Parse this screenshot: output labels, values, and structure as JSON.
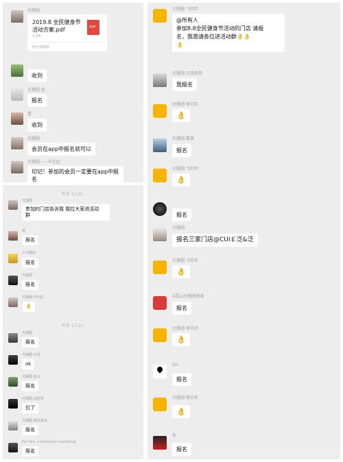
{
  "left_top": {
    "file_msg": {
      "sender": "光猪圈·",
      "file_name_1": "2019.8 全民健身节",
      "file_name_2": "活动方案.pdf",
      "file_size": "3.1M",
      "file_badge": "PDF",
      "file_source": "微信电脑版"
    },
    "messages": [
      {
        "name": "",
        "text": "收到"
      },
      {
        "name": "光猪圈·金..",
        "text": "报名"
      },
      {
        "name": "富",
        "text": "收到"
      },
      {
        "name": "光猪圈·",
        "text": "会员在app中报名就可以"
      },
      {
        "name": "光猪圈·― ·中北区",
        "text_1": "切记！参加的会员一定要在app中报",
        "text_2": "名"
      }
    ]
  },
  "left_bottom": {
    "time1": "昨天 12:05",
    "messages": [
      {
        "name": "光猪圈·",
        "text_1": "参加的门店告诉我 我拉大家进活动",
        "text_2": "群"
      },
      {
        "name": "富",
        "text": "报名"
      },
      {
        "name": "小马圈店",
        "text": "报名"
      },
      {
        "name": "光猪圈·",
        "text": "报名"
      },
      {
        "name": "光猪圈·中北区",
        "text": "👌"
      }
    ],
    "time2": "昨天 12:22",
    "messages2": [
      {
        "name": "光猪圈·",
        "text": "报名"
      },
      {
        "name": "光猪圈·云营",
        "text": "ok"
      },
      {
        "name": "光猪圈·金马",
        "text": "报名"
      },
      {
        "name": "光猪圈·运营店",
        "text": "拉了"
      },
      {
        "name": "光猪圈·健身房运..",
        "text": "报名"
      },
      {
        "name": "Fan Fan, Commercial marketing",
        "text": "报名"
      }
    ]
  },
  "right": {
    "top_msg": {
      "name": "光猪圈·飞欢欢",
      "line1": "@所有人",
      "line2": "参加8.8全民健身节活动的门店 请报",
      "line3": "名，我邀请各位进活动群👌👌",
      "line4": "👌"
    },
    "messages": [
      {
        "name": "光猪圈·江西南昌",
        "text": "我报名"
      },
      {
        "name": "光猪圈·崔欢欢",
        "text": "👌"
      },
      {
        "name": "光猪圈·嘉善",
        "text": "报名"
      },
      {
        "name": "光猪圈·飞欢欢",
        "text": "👌"
      },
      {
        "name": "",
        "text": "报名"
      },
      {
        "name": "光猪圈·",
        "text": "报名三家门店@CUI￡泛&泛"
      },
      {
        "name": "光猪圈·飞欢欢",
        "text": "👌"
      },
      {
        "name": "A昆山光猪圈健身",
        "text": "报名"
      },
      {
        "name": "光猪圈·崔欢欢",
        "text": "👌"
      },
      {
        "name": "ZH",
        "text": "报名"
      },
      {
        "name": "光猪圈·崔欢欢",
        "text": "👌"
      },
      {
        "name": "佐",
        "text": "报名"
      }
    ]
  },
  "colors": {
    "panel": "#ededed",
    "bubble": "#ffffff",
    "pdf_red": "#e8453c",
    "name_gray": "#a3a3a3"
  }
}
